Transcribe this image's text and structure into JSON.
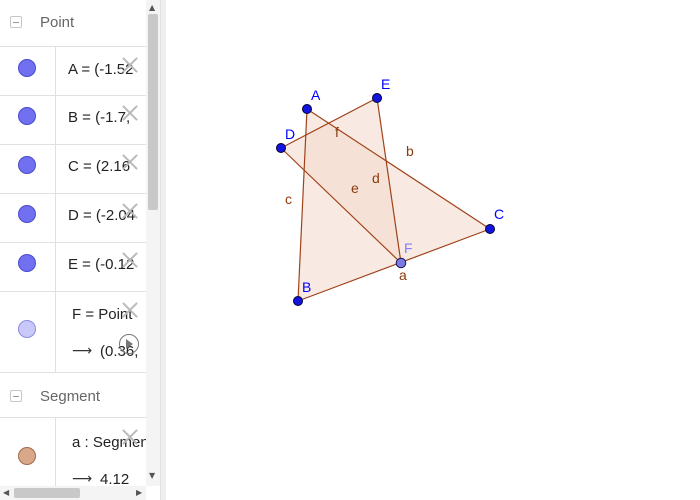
{
  "algebra": {
    "groups": [
      {
        "label": "Point"
      },
      {
        "label": "Segment"
      }
    ],
    "points": [
      {
        "definition": "A = (-1.52"
      },
      {
        "definition": "B = (-1.7,"
      },
      {
        "definition": "C = (2.16"
      },
      {
        "definition": "D = (-2.04"
      },
      {
        "definition": "E = (-0.12"
      }
    ],
    "point_f": {
      "definition": "F = Point",
      "arrow": "⟶",
      "value": "(0.36,"
    },
    "segment_a": {
      "definition": "a : Segment",
      "arrow": "⟶",
      "value": "4.12"
    }
  },
  "colors": {
    "point_blue": "#7070f0",
    "point_f": "#c8c8fa",
    "segment_marble": "#d9a88a",
    "triangle_fill": "#f3d9ca",
    "edge": "#a0421a",
    "point_label": "#0000ff",
    "segment_label": "#8b3a0e"
  },
  "graphics": {
    "points": [
      {
        "name": "A"
      },
      {
        "name": "B"
      },
      {
        "name": "C"
      },
      {
        "name": "D"
      },
      {
        "name": "E"
      },
      {
        "name": "F"
      }
    ],
    "segments": [
      {
        "name": "a"
      },
      {
        "name": "b"
      },
      {
        "name": "c"
      },
      {
        "name": "d"
      },
      {
        "name": "e"
      },
      {
        "name": "f"
      }
    ]
  }
}
